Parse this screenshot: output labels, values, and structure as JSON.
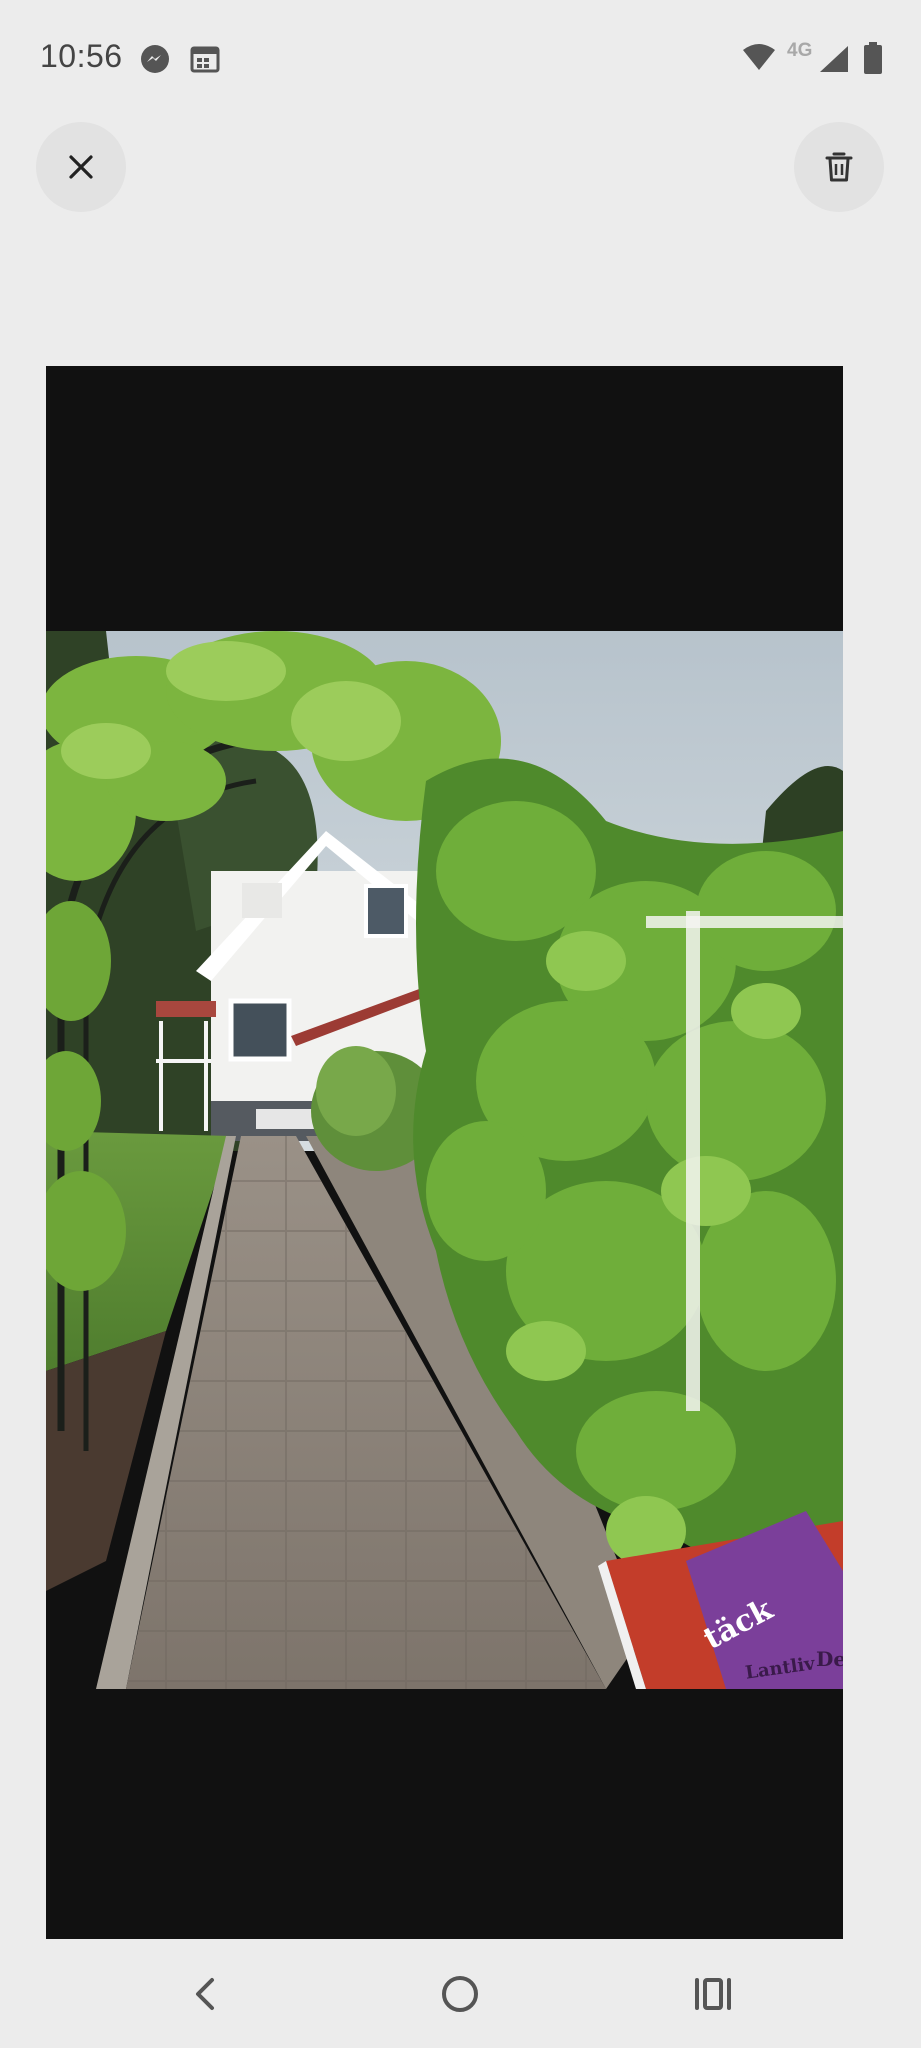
{
  "status_bar": {
    "time": "10:56",
    "network": "4G",
    "icons": [
      "messenger-icon",
      "calendar-icon",
      "wifi-icon",
      "signal-icon",
      "battery-icon"
    ]
  },
  "toolbar": {
    "close_icon": "close-icon",
    "delete_icon": "trash-icon"
  },
  "photo": {
    "bag_text_1": "Lantliv",
    "bag_text_2": "täck",
    "bag_text_3": "Del"
  },
  "nav_bar": {
    "icons": [
      "back-icon",
      "home-icon",
      "recents-icon"
    ]
  },
  "colors": {
    "background": "#ececec",
    "viewer_background": "#111111",
    "icon": "#444444"
  }
}
